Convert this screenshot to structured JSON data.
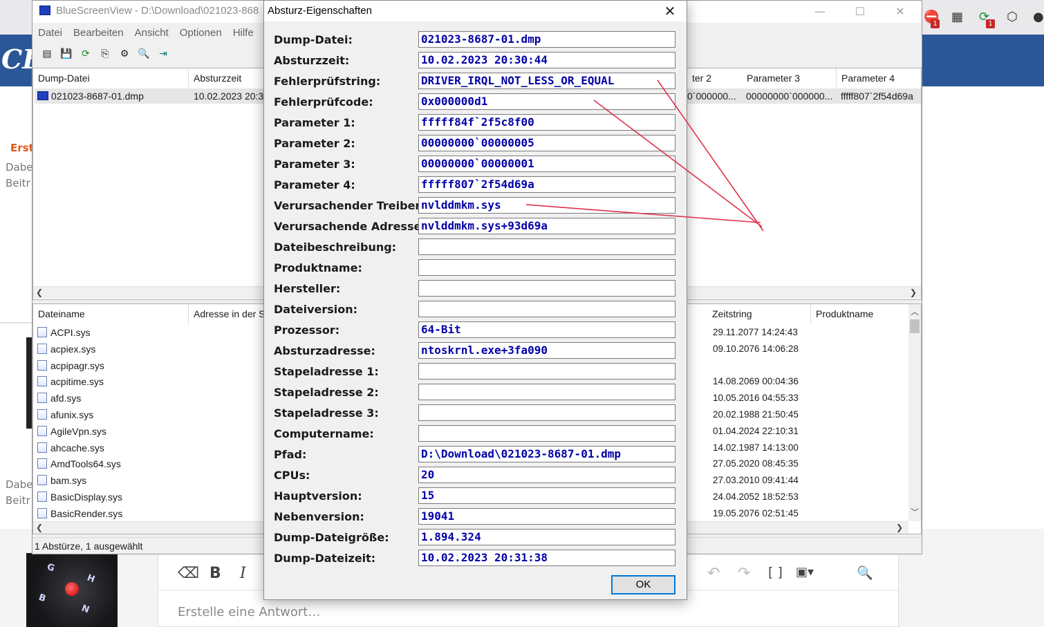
{
  "background": {
    "logo": "CB",
    "text_orange": "Erst",
    "text_gray_1": "Dabe",
    "text_gray_2": "Beitr",
    "text_gray_3": "Dabe",
    "text_gray_4": "Beitr",
    "editor_placeholder": "Erstelle eine Antwort…",
    "keyboard_keys": [
      "G",
      "H",
      "B",
      "N"
    ],
    "badges": [
      "1",
      "1"
    ]
  },
  "main_window": {
    "title": "BlueScreenView  -  D:\\Download\\021023-868",
    "menu": [
      "Datei",
      "Bearbeiten",
      "Ansicht",
      "Optionen",
      "Hilfe"
    ],
    "crash_list": {
      "headers_left": [
        "Dump-Datei",
        "Absturzzeit"
      ],
      "headers_right": [
        "ter 2",
        "Parameter 3",
        "Parameter 4"
      ],
      "row": {
        "dump_file": "021023-8687-01.dmp",
        "time": "10.02.2023 20:30",
        "param2": "0`000000...",
        "param3": "00000000`000000...",
        "param4": "fffff807`2f54d69a"
      }
    },
    "driver_list": {
      "headers_left": [
        "Dateiname",
        "Adresse in der S"
      ],
      "headers_right": [
        "Zeitstring",
        "Produktname"
      ],
      "files": [
        "ACPI.sys",
        "acpiex.sys",
        "acpipagr.sys",
        "acpitime.sys",
        "afd.sys",
        "afunix.sys",
        "AgileVpn.sys",
        "ahcache.sys",
        "AmdTools64.sys",
        "bam.sys",
        "BasicDisplay.sys",
        "BasicRender.sys"
      ],
      "timestamps": [
        "29.11.2077 14:24:43",
        "09.10.2076 14:06:28",
        "",
        "14.08.2069 00:04:36",
        "10.05.2016 04:55:33",
        "20.02.1988 21:50:45",
        "01.04.2024 22:10:31",
        "14.02.1987 14:13:00",
        "27.05.2020 08:45:35",
        "27.03.2010 09:41:44",
        "24.04.2052 18:52:53",
        "19.05.2076 02:51:45"
      ]
    },
    "status": "1 Abstürze, 1 ausgewählt"
  },
  "dialog": {
    "title": "Absturz-Eigenschaften",
    "fields": [
      {
        "label": "Dump-Datei:",
        "value": "021023-8687-01.dmp"
      },
      {
        "label": "Absturzzeit:",
        "value": "10.02.2023 20:30:44"
      },
      {
        "label": "Fehlerprüfstring:",
        "value": "DRIVER_IRQL_NOT_LESS_OR_EQUAL"
      },
      {
        "label": "Fehlerprüfcode:",
        "value": "0x000000d1"
      },
      {
        "label": "Parameter 1:",
        "value": "fffff84f`2f5c8f00"
      },
      {
        "label": "Parameter 2:",
        "value": "00000000`00000005"
      },
      {
        "label": "Parameter 3:",
        "value": "00000000`00000001"
      },
      {
        "label": "Parameter 4:",
        "value": "fffff807`2f54d69a"
      },
      {
        "label": "Verursachender Treiber:",
        "value": "nvlddmkm.sys"
      },
      {
        "label": "Verursachende Adresse:",
        "value": "nvlddmkm.sys+93d69a"
      },
      {
        "label": "Dateibeschreibung:",
        "value": ""
      },
      {
        "label": "Produktname:",
        "value": ""
      },
      {
        "label": "Hersteller:",
        "value": ""
      },
      {
        "label": "Dateiversion:",
        "value": ""
      },
      {
        "label": "Prozessor:",
        "value": "64-Bit"
      },
      {
        "label": "Absturzadresse:",
        "value": "ntoskrnl.exe+3fa090"
      },
      {
        "label": "Stapeladresse 1:",
        "value": ""
      },
      {
        "label": "Stapeladresse 2:",
        "value": ""
      },
      {
        "label": "Stapeladresse 3:",
        "value": ""
      },
      {
        "label": "Computername:",
        "value": ""
      },
      {
        "label": "Pfad:",
        "value": "D:\\Download\\021023-8687-01.dmp"
      },
      {
        "label": "CPUs:",
        "value": "20"
      },
      {
        "label": "Hauptversion:",
        "value": "15"
      },
      {
        "label": "Nebenversion:",
        "value": "19041"
      },
      {
        "label": "Dump-Dateigröße:",
        "value": "1.894.324"
      },
      {
        "label": "Dump-Dateizeit:",
        "value": "10.02.2023 20:31:38"
      }
    ],
    "ok_label": "OK"
  },
  "colors": {
    "banner": "#2b5797",
    "field_text": "#0000a8",
    "annotation": "#e0304a",
    "ok_border": "#0078d7"
  }
}
